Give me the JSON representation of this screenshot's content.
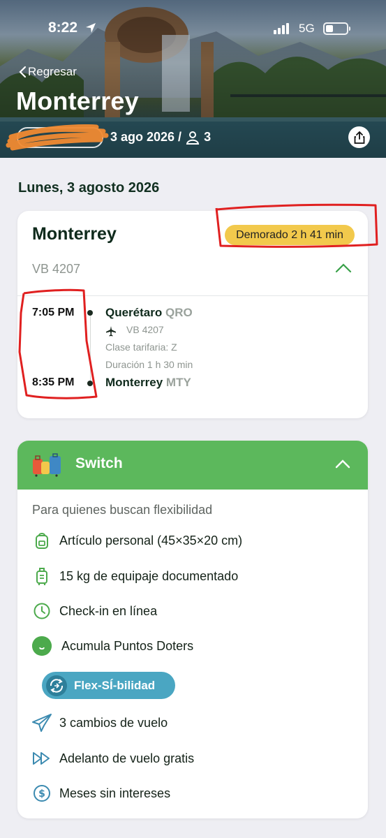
{
  "status_bar": {
    "time": "8:22",
    "network": "5G"
  },
  "header": {
    "back_label": "Regresar",
    "title": "Monterrey",
    "date_passengers": "3 ago 2026 /",
    "passengers": "3"
  },
  "date_heading": "Lunes, 3 agosto 2026",
  "flight_card": {
    "city": "Monterrey",
    "status": "Demorado 2 h 41 min",
    "flight_number": "VB 4207",
    "departure": {
      "time": "7:05 PM",
      "city": "Querétaro",
      "code": "QRO"
    },
    "segment_flight": "VB 4207",
    "fare_class": "Clase tarifaria: Z",
    "duration": "Duración 1 h 30 min",
    "arrival": {
      "time": "8:35 PM",
      "city": "Monterrey",
      "code": "MTY"
    }
  },
  "fare_card": {
    "name": "Switch",
    "subtitle": "Para quienes buscan flexibilidad",
    "benefits": [
      {
        "label": "Artículo personal (45×35×20 cm)",
        "icon": "backpack-icon"
      },
      {
        "label": "15 kg de equipaje documentado",
        "icon": "suitcase-icon"
      },
      {
        "label": "Check-in en línea",
        "icon": "clock-icon"
      },
      {
        "label": "Acumula Puntos Doters",
        "icon": "doters-icon"
      }
    ],
    "flex_label": "Flex-SÍ-bilidad",
    "extras": [
      {
        "label": "3 cambios de vuelo",
        "icon": "paper-plane-icon"
      },
      {
        "label": "Adelanto de vuelo gratis",
        "icon": "fast-forward-icon"
      },
      {
        "label": "Meses sin intereses",
        "icon": "dollar-coin-icon"
      }
    ]
  },
  "colors": {
    "accent_green": "#5cb85c",
    "delay_badge": "#f2c94c",
    "flex_pill": "#4aa6c2",
    "annotation_red": "#e02020"
  }
}
